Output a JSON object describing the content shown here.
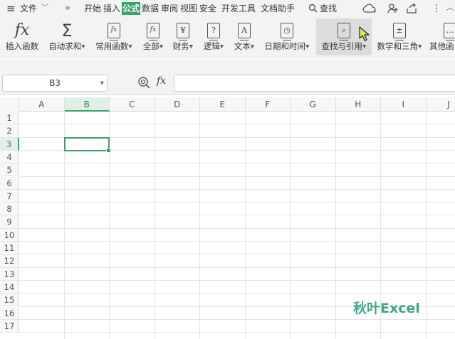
{
  "menubar": {
    "menu_icon": "≡",
    "file_label": "文件",
    "file_caret": "﹀",
    "more_icon": "»",
    "tabs": [
      "开始",
      "插入",
      "公式",
      "数据",
      "审阅",
      "视图",
      "安全",
      "开发工具",
      "文档助手"
    ],
    "active_tab": "公式",
    "search_label": "查找"
  },
  "ribbon": {
    "buttons": [
      {
        "label": "插入函数",
        "icon": "fx-icon",
        "glyph": "fx",
        "caret": false
      },
      {
        "label": "自动求和",
        "icon": "sigma-icon",
        "glyph": "Σ",
        "caret": true
      },
      {
        "label": "常用函数",
        "icon": "recent-functions-icon",
        "glyph": "fx",
        "caret": true
      },
      {
        "label": "全部",
        "icon": "all-functions-icon",
        "glyph": "fx",
        "caret": true
      },
      {
        "label": "财务",
        "icon": "finance-icon",
        "glyph": "¥",
        "caret": true
      },
      {
        "label": "逻辑",
        "icon": "logic-icon",
        "glyph": "?",
        "caret": true
      },
      {
        "label": "文本",
        "icon": "text-icon",
        "glyph": "A",
        "caret": true
      },
      {
        "label": "日期和时间",
        "icon": "datetime-icon",
        "glyph": "◷",
        "caret": true
      },
      {
        "label": "查找与引用",
        "icon": "lookup-icon",
        "glyph": "⌕",
        "caret": true
      },
      {
        "label": "数学和三角",
        "icon": "math-icon",
        "glyph": "±",
        "caret": true
      },
      {
        "label": "其他函",
        "icon": "more-functions-icon",
        "glyph": "…",
        "caret": false
      }
    ],
    "hovered": "查找与引用"
  },
  "formula_bar": {
    "name_box": "B3",
    "fx_label": "fx",
    "formula_value": ""
  },
  "sheet": {
    "columns": [
      "A",
      "B",
      "C",
      "D",
      "E",
      "F",
      "G",
      "H",
      "I",
      "J"
    ],
    "rows": [
      "1",
      "2",
      "3",
      "4",
      "5",
      "6",
      "7",
      "8",
      "9",
      "10",
      "11",
      "12",
      "13",
      "14",
      "15",
      "16",
      "17"
    ],
    "selected_cell": "B3",
    "selected_column": "B",
    "selected_row": "3"
  },
  "watermark": "秋叶Excel",
  "colors": {
    "accent": "#3aa266",
    "watermark": "#3fa78a"
  }
}
